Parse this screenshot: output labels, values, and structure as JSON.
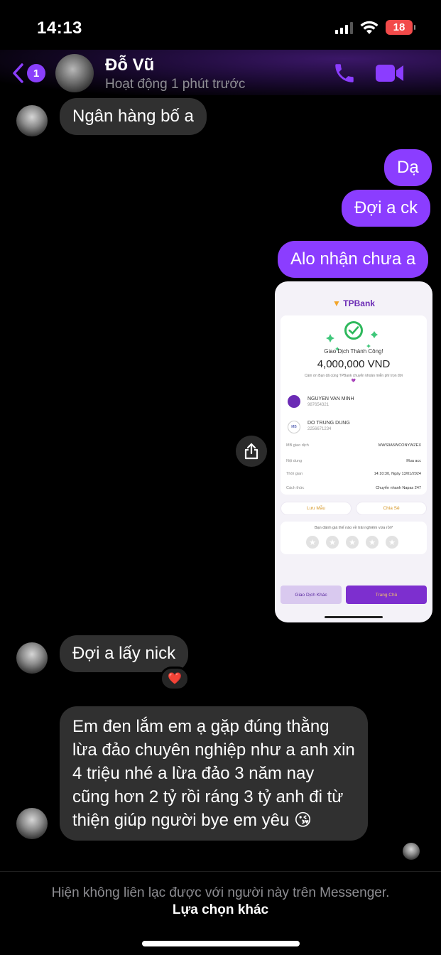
{
  "status_bar": {
    "time": "14:13",
    "battery": "18"
  },
  "header": {
    "unread_count": "1",
    "contact_name": "Đỗ Vũ",
    "contact_status": "Hoạt động 1 phút trước",
    "icons": {
      "back": "chevron-left-icon",
      "call": "phone-icon",
      "video": "video-camera-icon"
    },
    "accent_color": "#8b3dff"
  },
  "messages": [
    {
      "from": "them",
      "text": "Ngân hàng bố a"
    },
    {
      "from": "me",
      "text": "Dạ"
    },
    {
      "from": "me",
      "text": "Đợi a ck"
    },
    {
      "from": "me",
      "text": "Alo nhận chưa a"
    },
    {
      "from": "them",
      "text": "Đợi a lấy nick",
      "reaction": "❤️"
    },
    {
      "from": "them",
      "text": "Em đen lắm em ạ gặp đúng thằng lừa đảo chuyên nghiệp như a anh xin 4 triệu nhé a lừa đảo 3 năm nay cũng hơn 2 tỷ rồi ráng 3 tỷ anh đi từ thiện giúp người bye em yêu 😘"
    }
  ],
  "receipt": {
    "brand_prefix": "▼",
    "brand": "TPBank",
    "success_title": "Giao Dịch Thành Công!",
    "amount": "4,000,000 VND",
    "thanks": "Cảm ơn Bạn đã cùng TPBank chuyển khoản miễn phí trọn đời 💜",
    "sender_name": "NGUYEN VAN MINH",
    "sender_account": "987654321",
    "receiver_bank": "MB",
    "receiver_name": "DO TRUNG DUNG",
    "receiver_account": "2256671234",
    "details": [
      {
        "label": "MB giao dịch",
        "value": "MWS9A5WCONYWZEX"
      },
      {
        "label": "Nội dung",
        "value": "Mua acc"
      },
      {
        "label": "Thời gian",
        "value": "14:10:30, Ngày 13/01/2024"
      },
      {
        "label": "Cách thức",
        "value": "Chuyển nhanh Napas 247"
      }
    ],
    "save_label": "Lưu Mẫu",
    "share_label": "Chia Sẻ",
    "rating_question": "Bạn đánh giá thế nào về trải nghiệm vừa rồi?",
    "rating_stars": 0,
    "other_label": "Giao Dịch Khác",
    "home_label": "Trang Chủ"
  },
  "footer": {
    "notice": "Hiện không liên lạc được với người này trên Messenger.",
    "link": "Lựa chọn khác"
  }
}
